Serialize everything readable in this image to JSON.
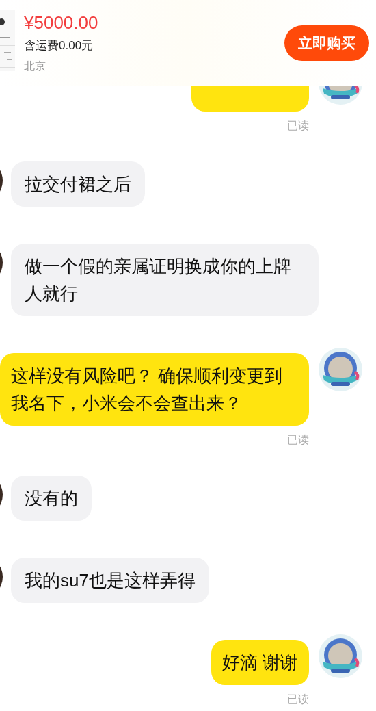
{
  "product": {
    "price": "¥5000.00",
    "shipping": "含运费0.00元",
    "location": "北京",
    "buy_button": "立即购买"
  },
  "messages": [
    {
      "kind": "sent",
      "status": "已读"
    },
    {
      "kind": "received",
      "text": "拉交付裙之后"
    },
    {
      "kind": "received",
      "text": "做一个假的亲属证明换成你的上牌人就行"
    },
    {
      "kind": "sent",
      "text": "这样没有风险吧？ 确保顺利变更到我名下，小米会不会查出来？",
      "status": "已读"
    },
    {
      "kind": "received",
      "text": "没有的"
    },
    {
      "kind": "received",
      "text": "我的su7也是这样弄得"
    },
    {
      "kind": "sent",
      "text": "好滴 谢谢",
      "status": "已读"
    }
  ]
}
